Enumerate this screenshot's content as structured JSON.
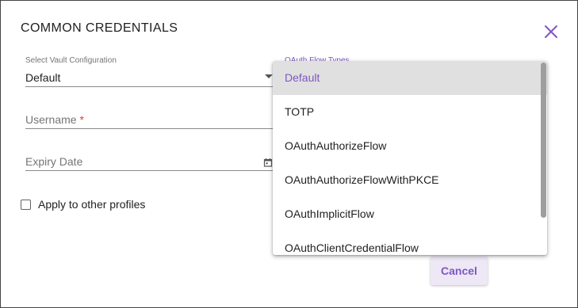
{
  "dialog": {
    "title": "COMMON CREDENTIALS",
    "close_icon": "close-icon"
  },
  "form": {
    "vault_label": "Select Vault Configuration",
    "vault_value": "Default",
    "username_placeholder": "Username",
    "username_required_mark": "*",
    "expiry_placeholder": "Expiry Date",
    "apply_label": "Apply to other profiles",
    "apply_checked": false,
    "oauth_label": "OAuth Flow Types"
  },
  "dropdown": {
    "options": [
      "Default",
      "TOTP",
      "OAuthAuthorizeFlow",
      "OAuthAuthorizeFlowWithPKCE",
      "OAuthImplicitFlow",
      "OAuthClientCredentialFlow"
    ],
    "selected": "Default"
  },
  "buttons": {
    "cancel": "Cancel"
  },
  "colors": {
    "accent": "#7e57c2",
    "accent_bg": "#ede7f6",
    "required": "#e53935",
    "selected_row": "#e0e0e0"
  }
}
